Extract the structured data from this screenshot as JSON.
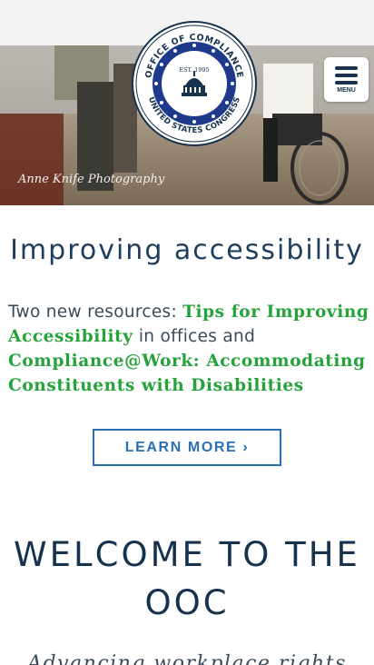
{
  "hero": {
    "photo_credit": "Anne Knife Photography"
  },
  "seal": {
    "top_text": "OFFICE OF COMPLIANCE",
    "bottom_text": "UNITED STATES CONGRESS",
    "center_text": "EST. 1995"
  },
  "menu": {
    "label": "MENU"
  },
  "feature": {
    "title": "Improving accessibility",
    "text_1": "Two new resources: ",
    "link_1": "Tips for Improving Accessibility",
    "text_2": " in offices and ",
    "link_2": "Compliance@Work: Accommodating Constituents with Disabilities",
    "button": "LEARN MORE ›"
  },
  "welcome": {
    "title": "WELCOME TO THE OOC",
    "tagline": "Advancing workplace rights"
  },
  "colors": {
    "navy": "#17324d",
    "link_green": "#25a33a",
    "button_blue": "#2a6fb3"
  }
}
